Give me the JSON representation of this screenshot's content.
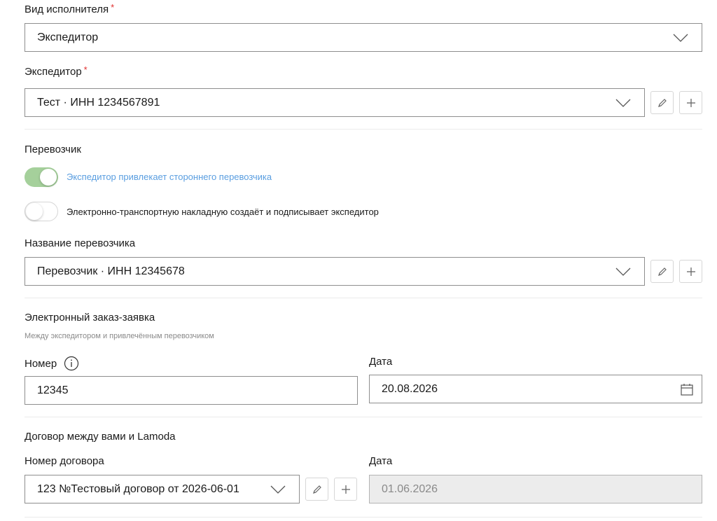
{
  "executor_type": {
    "label": "Вид исполнителя",
    "required_mark": "*",
    "value": "Экспедитор"
  },
  "forwarder": {
    "label": "Экспедитор",
    "required_mark": "*",
    "value": "Тест · ИНН 1234567891"
  },
  "carrier": {
    "section_title": "Перевозчик",
    "toggle_third_party": {
      "label": "Экспедитор привлекает стороннего перевозчика",
      "on": true
    },
    "toggle_waybill": {
      "label": "Электронно-транспортную накладную создаёт и подписывает экспедитор",
      "on": false
    },
    "name_label": "Название перевозчика",
    "name_value": "Перевозчик · ИНН 12345678"
  },
  "order": {
    "title": "Электронный заказ-заявка",
    "subtitle": "Между экспедитором и привлечённым перевозчиком",
    "number_label": "Номер",
    "number_value": "12345",
    "date_label": "Дата",
    "date_value": "20.08.2026"
  },
  "contract": {
    "title": "Договор между вами и Lamoda",
    "number_label": "Номер договора",
    "number_value": "123 №Тестовый договор от 2026-06-01",
    "date_label": "Дата",
    "date_value": "01.06.2026"
  },
  "icons": {
    "chevron": "chevron-down-icon",
    "edit": "pencil-icon",
    "add": "plus-icon",
    "info": "info-icon",
    "calendar": "calendar-icon"
  },
  "colors": {
    "required": "#e0302f",
    "toggle_on": "#a5d09b",
    "link_blue": "#5a9ee0",
    "border": "#8e8e8e"
  }
}
